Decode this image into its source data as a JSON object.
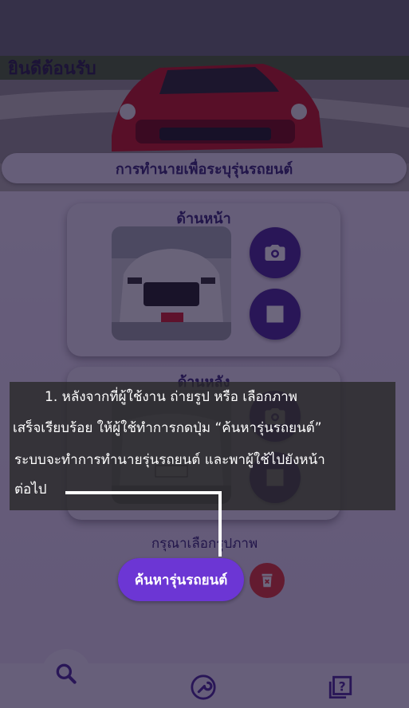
{
  "header": {
    "welcome": "ยินดีต้อนรับ"
  },
  "page_title": "การทำนายเพื่อระบุรุ่นรถยนต์",
  "front_card": {
    "label": "ด้านหน้า"
  },
  "back_card": {
    "label": "ด้านหลัง"
  },
  "hint": "กรุณาเลือกรูปภาพ",
  "actions": {
    "search_label": "ค้นหารุ่นรถยนต์"
  },
  "icons": {
    "camera": "camera-icon",
    "gallery": "image-icon",
    "delete": "delete-icon",
    "search": "search-icon",
    "wrench": "wrench-icon",
    "help": "help-icon"
  },
  "tutorial": {
    "lines": [
      "1. หลังจากที่ผู้ใช้งาน ถ่ายรูป หรือ เลือกภาพ",
      "เสร็จเรียบร้อย ให้ผู้ใช้ทำการกดปุ่ม “ค้นหารุ่นรถยนต์”",
      "ระบบจะทำการทำนายรุ่นรถยนต์ และพาผู้ใช้ไปยังหน้า",
      "ต่อไป"
    ]
  },
  "colors": {
    "primary": "#4d2a9c",
    "accent": "#8a4fe0",
    "danger": "#e53935",
    "text": "#3a2a7a"
  }
}
